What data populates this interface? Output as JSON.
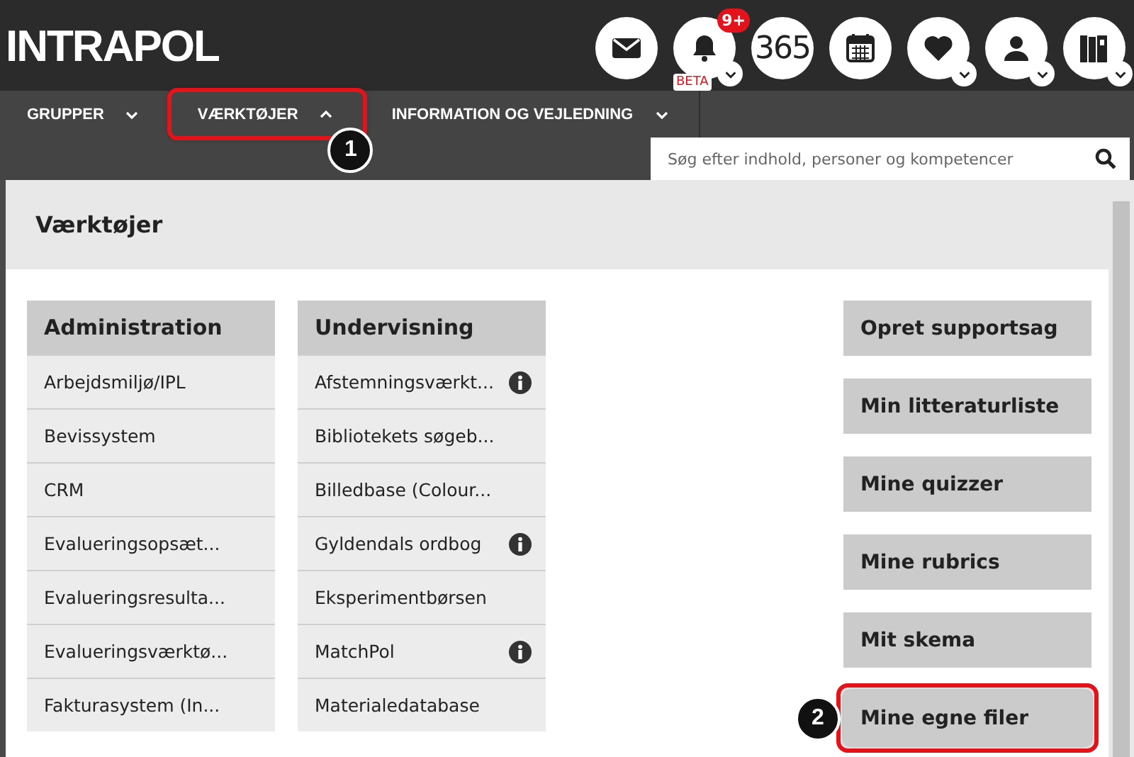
{
  "header": {
    "logo": "INTRAPOL",
    "icons": [
      {
        "kind": "mail",
        "dropdown": false
      },
      {
        "kind": "bell",
        "dropdown": true,
        "badge": "9+",
        "label": "BETA"
      },
      {
        "kind": "text",
        "text": "365",
        "dropdown": false
      },
      {
        "kind": "calendar",
        "dropdown": false
      },
      {
        "kind": "heart",
        "dropdown": true
      },
      {
        "kind": "person",
        "dropdown": true
      },
      {
        "kind": "books",
        "dropdown": true
      }
    ]
  },
  "nav": {
    "items": [
      {
        "label": "GRUPPER",
        "expanded": false,
        "highlighted": false
      },
      {
        "label": "VÆRKTØJER",
        "expanded": true,
        "highlighted": true,
        "callout": "1"
      },
      {
        "label": "INFORMATION OG VEJLEDNING",
        "expanded": false,
        "highlighted": false
      }
    ],
    "search": {
      "placeholder": "Søg efter indhold, personer og kompetencer"
    }
  },
  "panel": {
    "title": "Værktøjer",
    "columns": [
      {
        "heading": "Administration",
        "items": [
          {
            "label": "Arbejdsmiljø/IPL",
            "info": false
          },
          {
            "label": "Bevissystem",
            "info": false
          },
          {
            "label": "CRM",
            "info": false
          },
          {
            "label": "Evalueringsopsæt...",
            "info": false
          },
          {
            "label": "Evalueringsresulta...",
            "info": false
          },
          {
            "label": "Evalueringsværktø...",
            "info": false
          },
          {
            "label": "Fakturasystem (In...",
            "info": false
          }
        ]
      },
      {
        "heading": "Undervisning",
        "items": [
          {
            "label": "Afstemningsværkt...",
            "info": true
          },
          {
            "label": "Bibliotekets søgeb...",
            "info": false
          },
          {
            "label": "Billedbase (Colour...",
            "info": false
          },
          {
            "label": "Gyldendals ordbog",
            "info": true
          },
          {
            "label": "Eksperimentbørsen",
            "info": false
          },
          {
            "label": "MatchPol",
            "info": true
          },
          {
            "label": "Materialedatabase",
            "info": false
          }
        ]
      }
    ],
    "buttons": [
      {
        "label": "Opret supportsag",
        "highlighted": false
      },
      {
        "label": "Min litteraturliste",
        "highlighted": false
      },
      {
        "label": "Mine quizzer",
        "highlighted": false
      },
      {
        "label": "Mine rubrics",
        "highlighted": false
      },
      {
        "label": "Mit skema",
        "highlighted": false
      },
      {
        "label": "Mine egne filer",
        "highlighted": true,
        "callout": "2"
      }
    ]
  }
}
